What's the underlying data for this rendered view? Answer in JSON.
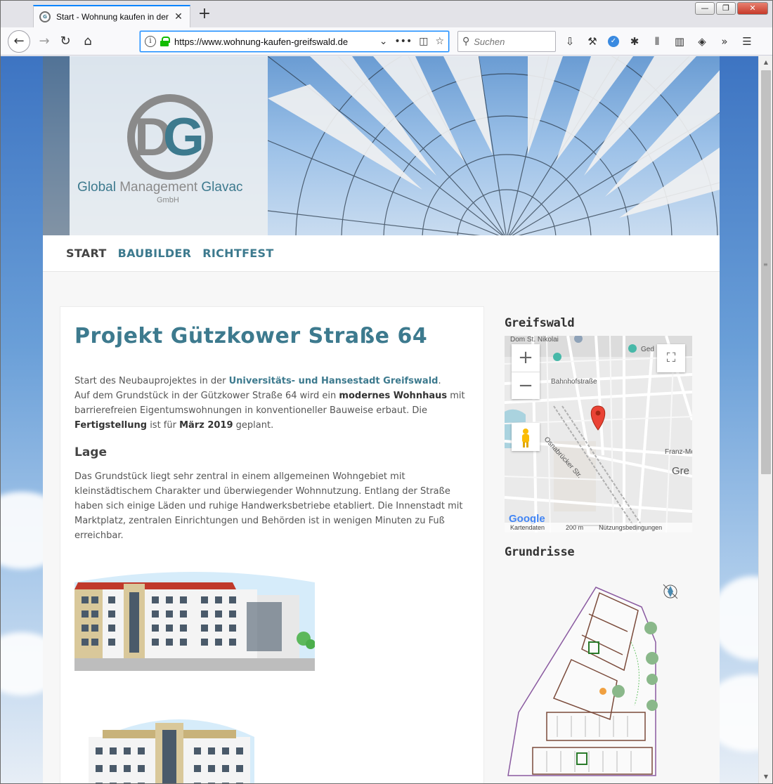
{
  "browser": {
    "tab_title": "Start - Wohnung kaufen in der",
    "url": "https://www.wohnung-kaufen-greifswald.de",
    "search_placeholder": "Suchen"
  },
  "logo": {
    "name_part1": "Global",
    "name_part2": "Management",
    "name_part3": "Glavac",
    "gmbh": "GmbH"
  },
  "menu": {
    "items": [
      {
        "label": "START"
      },
      {
        "label": "BAUBILDER"
      },
      {
        "label": "RICHTFEST"
      }
    ]
  },
  "main": {
    "title": "Projekt Gützkower Straße 64",
    "intro": {
      "t1": "Start des Neubauprojektes in der ",
      "link": "Universitäts- und Hansestadt Greifswald",
      "t2": ".",
      "t3": "Auf dem Grundstück in der Gützkower Straße 64 wird ein ",
      "b1": "modernes Wohnhaus",
      "t4": " mit barrierefreien Eigentumswohnungen in konventioneller Bauweise erbaut. Die ",
      "b2": "Fertigstellung",
      "t5": " ist für ",
      "b3": "März 2019",
      "t6": " geplant."
    },
    "lage_heading": "Lage",
    "lage_text": "Das Grundstück liegt sehr zentral in einem allgemeinen Wohngebiet mit kleinstädtischem Charakter und überwiegender Wohnnutzung. Entlang der Straße haben sich einige Läden und ruhige Handwerksbetriebe etabliert. Die Innenstadt mit Marktplatz, zentralen Einrichtungen und Behörden ist in wenigen Minuten zu Fuß erreichbar."
  },
  "sidebar": {
    "map_heading": "Greifswald",
    "plans_heading": "Grundrisse",
    "map": {
      "labels": {
        "dom": "Dom St. Nikolai",
        "ged": "Ged",
        "bahnhof": "Bahnhofstraße",
        "osnab": "Osnabrücker Str.",
        "franz": "Franz-Me",
        "gre": "Gre",
        "kartendaten": "Kartendaten",
        "scale": "200 m",
        "nutzung": "Nutzungsbedingungen",
        "google": "Google"
      }
    }
  }
}
